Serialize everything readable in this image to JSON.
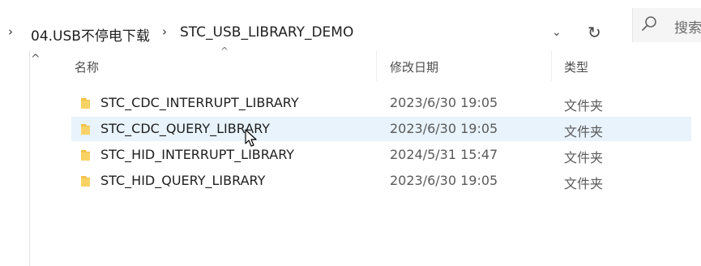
{
  "address_bar": {
    "crumbs": [
      "04.USB不停电下载",
      "STC_USB_LIBRARY_DEMO"
    ],
    "search_placeholder": "搜索"
  },
  "columns": {
    "name": "名称",
    "date": "修改日期",
    "type": "类型"
  },
  "files": [
    {
      "name": "STC_CDC_INTERRUPT_LIBRARY",
      "date": "2023/6/30 19:05",
      "type": "文件夹"
    },
    {
      "name": "STC_CDC_QUERY_LIBRARY",
      "date": "2023/6/30 19:05",
      "type": "文件夹"
    },
    {
      "name": "STC_HID_INTERRUPT_LIBRARY",
      "date": "2024/5/31 15:47",
      "type": "文件夹"
    },
    {
      "name": "STC_HID_QUERY_LIBRARY",
      "date": "2023/6/30 19:05",
      "type": "文件夹"
    }
  ],
  "hovered_row": 1,
  "colors": {
    "folder": "#f3c24a",
    "hover": "#e8f3fc"
  }
}
